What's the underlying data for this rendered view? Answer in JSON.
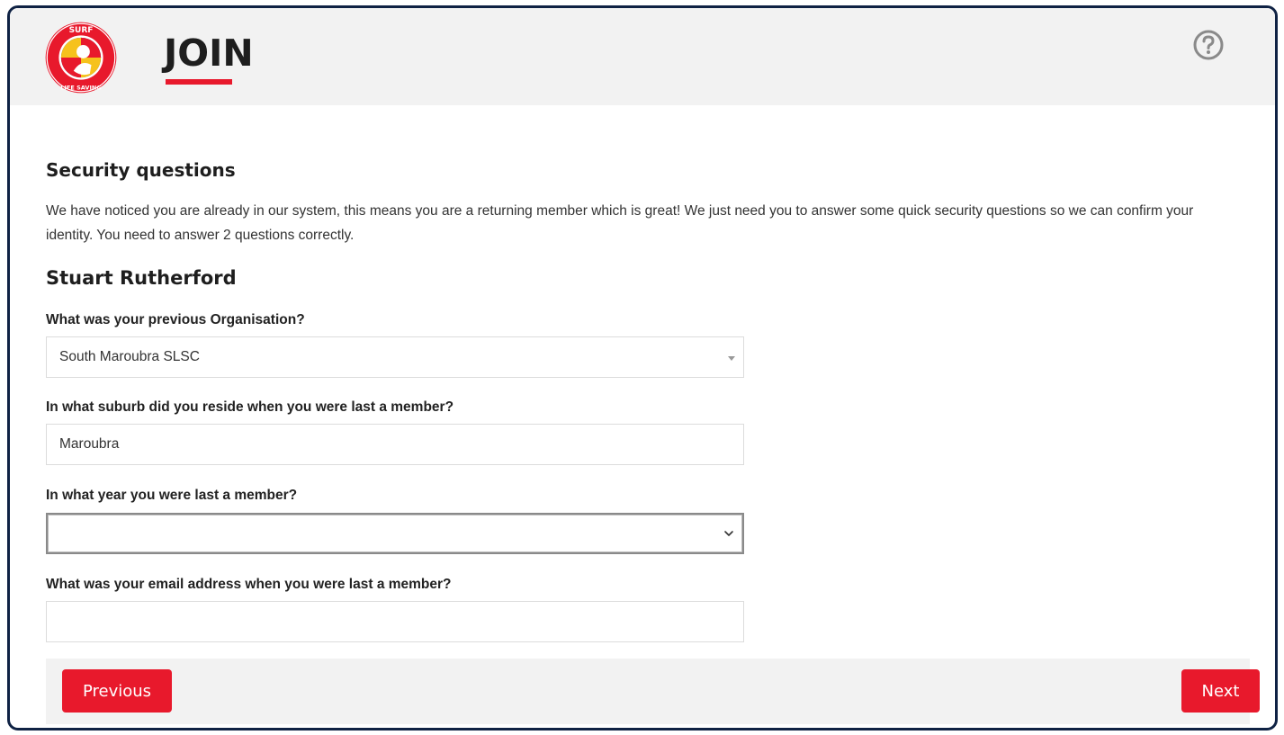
{
  "header": {
    "logo_text_top": "SURF",
    "logo_text_bottom": "LIFE SAVING",
    "title": "JOIN",
    "help_icon": "question-circle-icon",
    "accent_color": "#e8192c"
  },
  "section": {
    "title": "Security questions",
    "intro": "We have noticed you are already in our system, this means you are a returning member which is great! We just need you to answer some quick security questions so we can confirm your identity. You need to answer 2 questions correctly.",
    "member_name": "Stuart Rutherford"
  },
  "questions": {
    "organisation": {
      "label": "What was your previous Organisation?",
      "value": "South Maroubra SLSC"
    },
    "suburb": {
      "label": "In what suburb did you reside when you were last a member?",
      "value": "Maroubra"
    },
    "year": {
      "label": "In what year you were last a member?",
      "value": ""
    },
    "email": {
      "label": "What was your email address when you were last a member?",
      "value": ""
    }
  },
  "footer": {
    "previous_label": "Previous",
    "next_label": "Next"
  }
}
